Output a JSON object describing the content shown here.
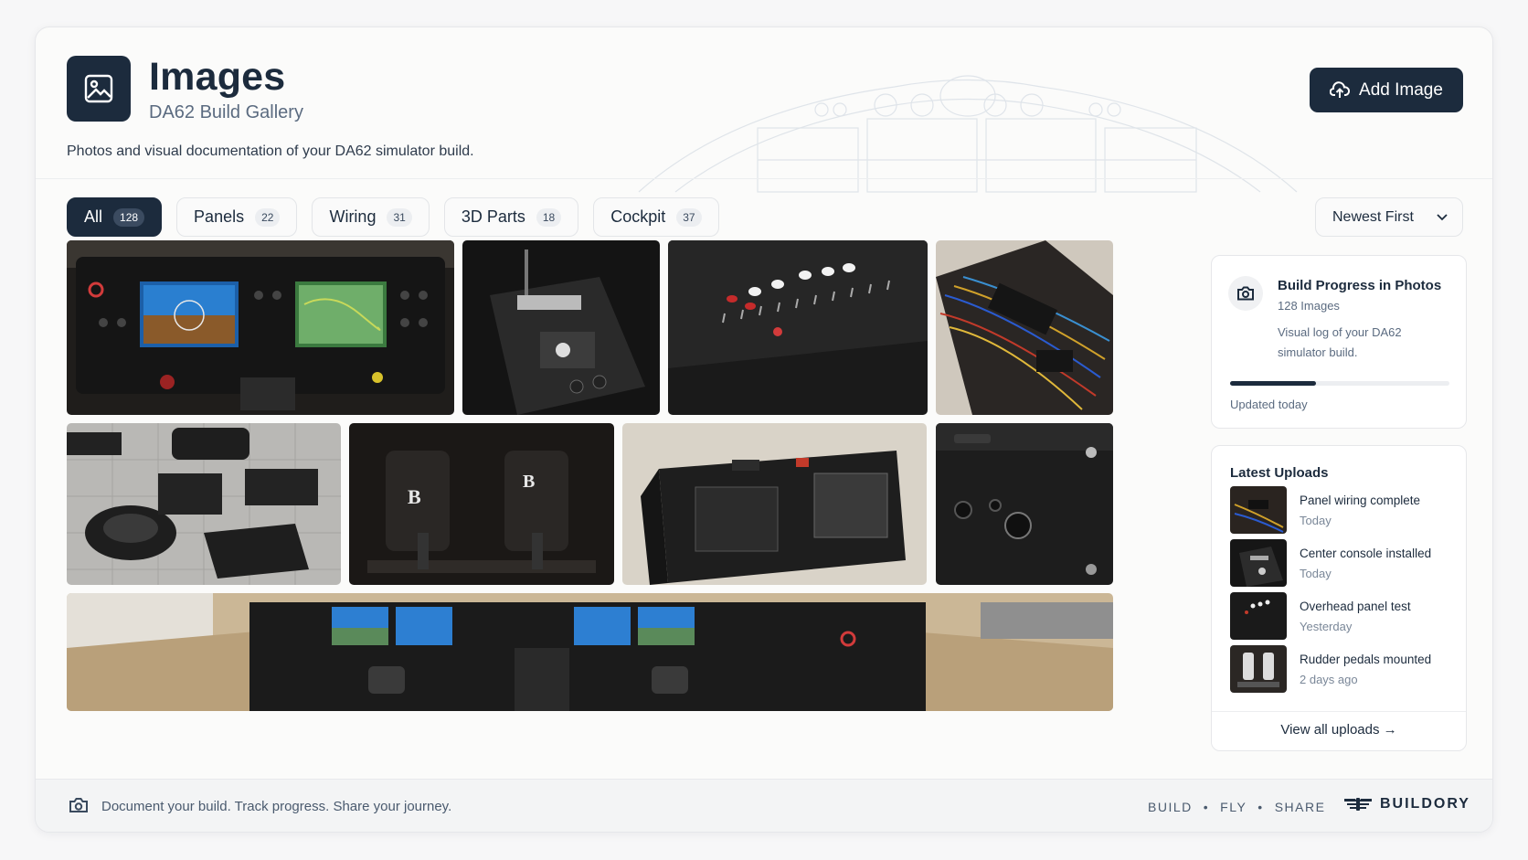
{
  "header": {
    "title": "Images",
    "subtitle": "DA62 Build Gallery",
    "description": "Photos and visual documentation of your DA62 simulator build.",
    "add_button": "Add Image"
  },
  "filters": [
    {
      "label": "All",
      "count": "128",
      "active": true
    },
    {
      "label": "Panels",
      "count": "22",
      "active": false
    },
    {
      "label": "Wiring",
      "count": "31",
      "active": false
    },
    {
      "label": "3D Parts",
      "count": "18",
      "active": false
    },
    {
      "label": "Cockpit",
      "count": "37",
      "active": false
    }
  ],
  "sort": {
    "selected": "Newest First"
  },
  "gallery": [
    {
      "subject": "instrument-panel-displays"
    },
    {
      "subject": "center-console-throttle"
    },
    {
      "subject": "overhead-switch-panel"
    },
    {
      "subject": "wiring-harness"
    },
    {
      "subject": "3d-printed-parts"
    },
    {
      "subject": "rudder-pedals"
    },
    {
      "subject": "avionics-panel-frame"
    },
    {
      "subject": "flaps-trim-panel"
    },
    {
      "subject": "full-cockpit-panorama"
    }
  ],
  "progress": {
    "title": "Build Progress in Photos",
    "count": "128 Images",
    "description": "Visual log of your DA62 simulator build.",
    "progress_fraction": 0.39,
    "updated": "Updated today"
  },
  "uploads": {
    "title": "Latest Uploads",
    "items": [
      {
        "title": "Panel wiring complete",
        "time": "Today"
      },
      {
        "title": "Center console installed",
        "time": "Today"
      },
      {
        "title": "Overhead panel test",
        "time": "Yesterday"
      },
      {
        "title": "Rudder pedals mounted",
        "time": "2 days ago"
      }
    ],
    "view_all": "View all uploads →"
  },
  "footer": {
    "text": "Document your build. Track progress. Share your journey.",
    "tagline": [
      "BUILD",
      "•",
      "FLY",
      "•",
      "SHARE"
    ],
    "brand": "BUILDORY"
  },
  "colors": {
    "primary": "#1c2b3d",
    "muted": "#5b6b80",
    "background": "#fbfbfa"
  }
}
